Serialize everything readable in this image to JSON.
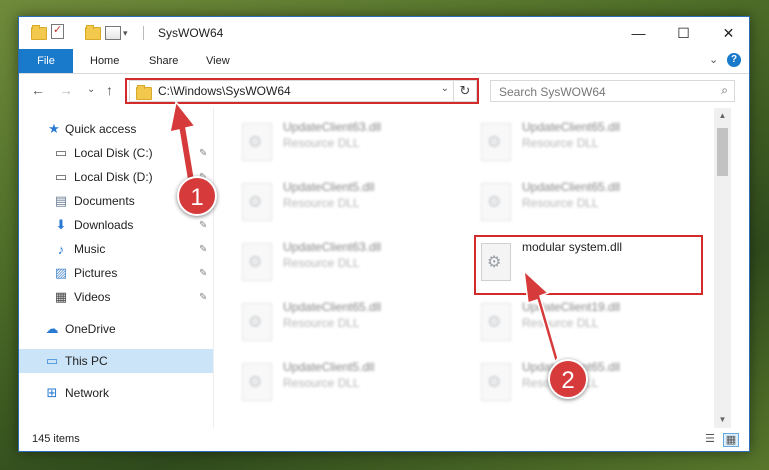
{
  "window": {
    "title": "SysWOW64",
    "controls": {
      "minimize": "—",
      "maximize": "☐",
      "close": "✕"
    }
  },
  "ribbon": {
    "tabs": [
      "File",
      "Home",
      "Share",
      "View"
    ],
    "expand_glyph": "⌄",
    "help_glyph": "?"
  },
  "nav": {
    "back": "←",
    "forward": "→",
    "recent": "⌄",
    "up": "↑",
    "address": "C:\\Windows\\SysWOW64",
    "address_dropdown": "⌄",
    "refresh": "↻"
  },
  "search": {
    "placeholder": "Search SysWOW64",
    "value": "",
    "icon": "⌕"
  },
  "sidebar": {
    "items": [
      {
        "label": "Quick access",
        "icon": "star-icon",
        "glyph": "★",
        "color": "#2a7ad3",
        "pinned": false
      },
      {
        "label": "Local Disk (C:)",
        "icon": "drive-icon",
        "glyph": "▭",
        "color": "#555555",
        "pinned": true
      },
      {
        "label": "Local Disk (D:)",
        "icon": "drive-icon",
        "glyph": "▭",
        "color": "#555555",
        "pinned": true
      },
      {
        "label": "Documents",
        "icon": "documents-icon",
        "glyph": "▤",
        "color": "#6a7d93",
        "pinned": true
      },
      {
        "label": "Downloads",
        "icon": "download-icon",
        "glyph": "⬇",
        "color": "#2a7ad3",
        "pinned": true
      },
      {
        "label": "Music",
        "icon": "music-icon",
        "glyph": "♪",
        "color": "#2a7ad3",
        "pinned": true
      },
      {
        "label": "Pictures",
        "icon": "pictures-icon",
        "glyph": "▨",
        "color": "#4c88c9",
        "pinned": true
      },
      {
        "label": "Videos",
        "icon": "videos-icon",
        "glyph": "▦",
        "color": "#444444",
        "pinned": true
      },
      {
        "label": "OneDrive",
        "icon": "cloud-icon",
        "glyph": "☁",
        "color": "#2a7ad3",
        "pinned": false
      },
      {
        "label": "This PC",
        "icon": "computer-icon",
        "glyph": "▭",
        "color": "#3a8ad8",
        "pinned": false,
        "selected": true
      },
      {
        "label": "Network",
        "icon": "network-icon",
        "glyph": "⊞",
        "color": "#2a7ad3",
        "pinned": false
      }
    ],
    "pin_glyph": "📌"
  },
  "files": [
    {
      "name": "UpdateClient63.dll",
      "type": "Resource DLL",
      "blurred": true
    },
    {
      "name": "UpdateClient65.dll",
      "type": "Resource DLL",
      "blurred": true
    },
    {
      "name": "UpdateClient5.dll",
      "type": "Resource DLL",
      "blurred": true
    },
    {
      "name": "UpdateClient65.dll",
      "type": "Resource DLL",
      "blurred": true
    },
    {
      "name": "UpdateClient63.dll",
      "type": "Resource DLL",
      "blurred": true
    },
    {
      "name": "modular system.dll",
      "type": "",
      "blurred": false
    },
    {
      "name": "UpdateClient65.dll",
      "type": "Resource DLL",
      "blurred": true
    },
    {
      "name": "UpdateClient19.dll",
      "type": "Resource DLL",
      "blurred": true
    },
    {
      "name": "UpdateClient5.dll",
      "type": "Resource DLL",
      "blurred": true
    },
    {
      "name": "UpdateClient65.dll",
      "type": "Resource DLL",
      "blurred": true
    }
  ],
  "status": {
    "count": "145 items"
  },
  "annotations": {
    "badge_1": "1",
    "badge_2": "2",
    "color": "#d32a2a"
  }
}
